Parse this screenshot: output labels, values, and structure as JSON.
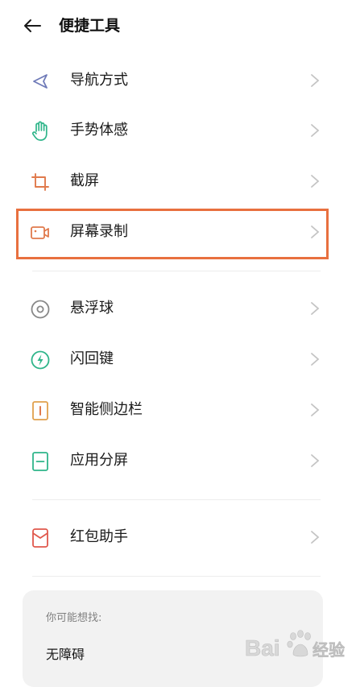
{
  "header": {
    "title": "便捷工具",
    "back_icon": "arrow-left-icon"
  },
  "colors": {
    "icon_blue": "#6e7ab8",
    "icon_green": "#2fb58a",
    "icon_orange": "#e07a4c",
    "icon_gray": "#888888",
    "highlight_border": "#e8703f",
    "chevron": "#c4c4c4"
  },
  "menu": {
    "group1": [
      {
        "label": "导航方式",
        "icon": "navigation-arrow-icon"
      },
      {
        "label": "手势体感",
        "icon": "hand-gesture-icon"
      },
      {
        "label": "截屏",
        "icon": "crop-screenshot-icon"
      },
      {
        "label": "屏幕录制",
        "icon": "video-camera-icon",
        "highlighted": true
      }
    ],
    "group2": [
      {
        "label": "悬浮球",
        "icon": "floating-ball-icon"
      },
      {
        "label": "闪回键",
        "icon": "flash-back-icon"
      },
      {
        "label": "智能侧边栏",
        "icon": "sidebar-icon"
      },
      {
        "label": "应用分屏",
        "icon": "split-screen-icon"
      }
    ],
    "group3": [
      {
        "label": "红包助手",
        "icon": "red-envelope-icon"
      }
    ]
  },
  "suggestions": {
    "heading": "你可能想找:",
    "items": [
      "无障碍"
    ]
  },
  "watermark": {
    "brand": "Bai",
    "brand_suffix": "经验"
  }
}
